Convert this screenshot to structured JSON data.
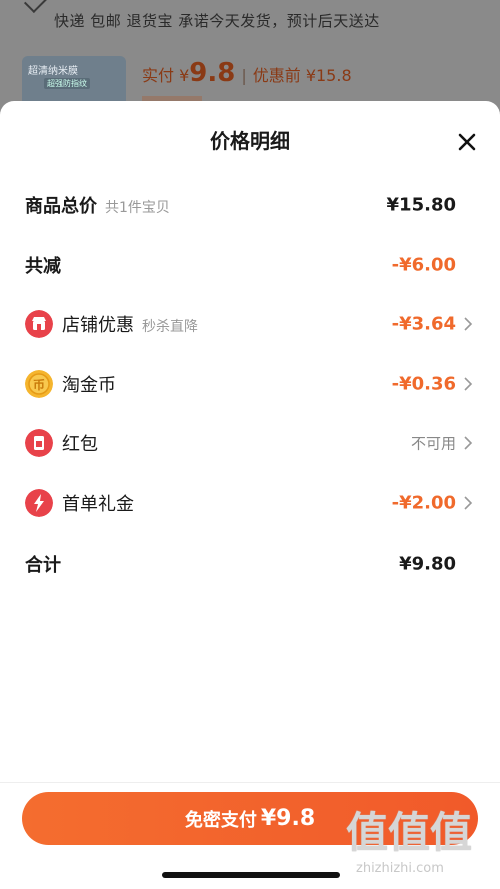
{
  "background": {
    "shipping_text": "快递 包邮 退货宝 承诺今天发货，预计后天送达",
    "thumb_title": "超清纳米膜",
    "thumb_tag": "超强防指纹",
    "paid_label": "实付 ¥",
    "paid_value": "9.8",
    "original_label": "优惠前 ¥15.8"
  },
  "sheet": {
    "title": "价格明细"
  },
  "rows": [
    {
      "label": "商品总价",
      "sub": "共1件宝贝",
      "value": "¥15.80",
      "style": "black"
    },
    {
      "label": "共减",
      "value": "-¥6.00",
      "style": "orange"
    },
    {
      "label": "店铺优惠",
      "sub": "秒杀直降",
      "value": "-¥3.64",
      "style": "orange",
      "icon": "shop-icon"
    },
    {
      "label": "淘金币",
      "value": "-¥0.36",
      "style": "orange",
      "icon": "gold-coin-icon"
    },
    {
      "label": "红包",
      "value": "不可用",
      "style": "gray",
      "icon": "red-packet-icon"
    },
    {
      "label": "首单礼金",
      "value": "-¥2.00",
      "style": "orange",
      "icon": "lightning-icon"
    },
    {
      "label": "合计",
      "value": "¥9.80",
      "style": "black"
    }
  ],
  "pay_button": {
    "label": "免密支付",
    "amount": "¥9.8"
  },
  "watermark": {
    "logo": "值值值",
    "url": "zhizhizhi.com"
  },
  "colors": {
    "accent_orange": "#f06a2c",
    "button_orange": "#f15a2a",
    "shop_red": "#e8424a",
    "coin_gold": "#f5b52e"
  }
}
